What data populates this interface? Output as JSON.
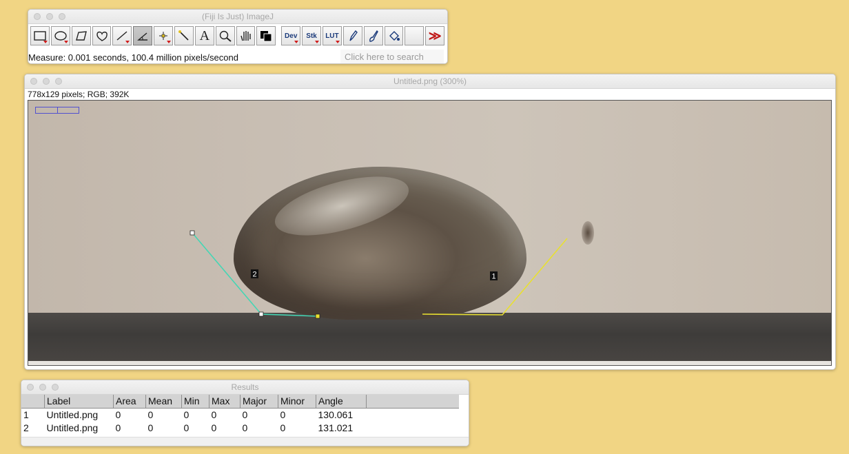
{
  "fiji": {
    "title": "(Fiji Is Just) ImageJ",
    "status": "Measure: 0.001 seconds, 100.4 million pixels/second",
    "search_placeholder": "Click here to search",
    "tools": [
      {
        "name": "rectangle-tool-icon",
        "label": ""
      },
      {
        "name": "oval-tool-icon",
        "label": ""
      },
      {
        "name": "polygon-tool-icon",
        "label": ""
      },
      {
        "name": "freehand-tool-icon",
        "label": ""
      },
      {
        "name": "line-tool-icon",
        "label": ""
      },
      {
        "name": "angle-tool-icon",
        "label": ""
      },
      {
        "name": "point-tool-icon",
        "label": ""
      },
      {
        "name": "wand-tool-icon",
        "label": ""
      },
      {
        "name": "text-tool-icon",
        "label": "A"
      },
      {
        "name": "magnifier-tool-icon",
        "label": ""
      },
      {
        "name": "hand-tool-icon",
        "label": ""
      },
      {
        "name": "color-picker-icon",
        "label": ""
      }
    ],
    "dev_label": "Dev",
    "stk_label": "Stk",
    "lut_label": "LUT"
  },
  "image_window": {
    "title": "Untitled.png (300%)",
    "info": "778x129 pixels; RGB; 392K",
    "roi_labels": [
      "2",
      "1"
    ],
    "colors": {
      "roi_cyan": "#44d6b4",
      "roi_yellow": "#e8e030"
    }
  },
  "results": {
    "title": "Results",
    "columns": [
      "",
      "Label",
      "Area",
      "Mean",
      "Min",
      "Max",
      "Major",
      "Minor",
      "Angle"
    ],
    "rows": [
      [
        "1",
        "Untitled.png",
        "0",
        "0",
        "0",
        "0",
        "0",
        "0",
        "130.061"
      ],
      [
        "2",
        "Untitled.png",
        "0",
        "0",
        "0",
        "0",
        "0",
        "0",
        "131.021"
      ]
    ]
  }
}
